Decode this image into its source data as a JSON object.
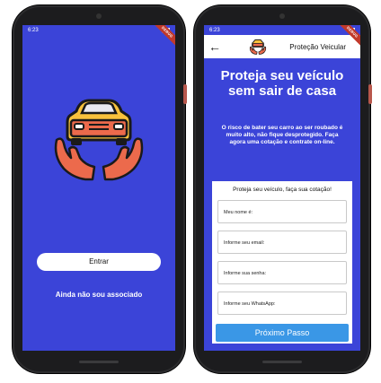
{
  "left_screen": {
    "status_time": "6:23",
    "debug_banner": "DEBUG",
    "enter_button": "Entrar",
    "associate_link": "Ainda não sou associado"
  },
  "right_screen": {
    "status_time": "6:23",
    "debug_banner": "DEBUG",
    "appbar_title": "Proteção Veicular",
    "back_icon": "arrow-left-icon",
    "hero_title": "Proteja seu veículo sem sair de casa",
    "description": "O risco de bater seu carro ao ser roubado é muito alto, não fique desprotegido. Faça agora uma cotação e contrate on-line.",
    "form_title": "Proteja seu veículo, faça sua cotação!",
    "fields": {
      "name": "Meu nome é:",
      "email": "Informe seu email:",
      "password": "Informe sua senha:",
      "whatsapp": "Informe seu WhatsApp:"
    },
    "next_button": "Próximo Passo"
  },
  "colors": {
    "screen_bg": "#3b44d8",
    "car": "#f9c23c",
    "hands": "#ec6a4c",
    "button_blue": "#3a97e6"
  }
}
